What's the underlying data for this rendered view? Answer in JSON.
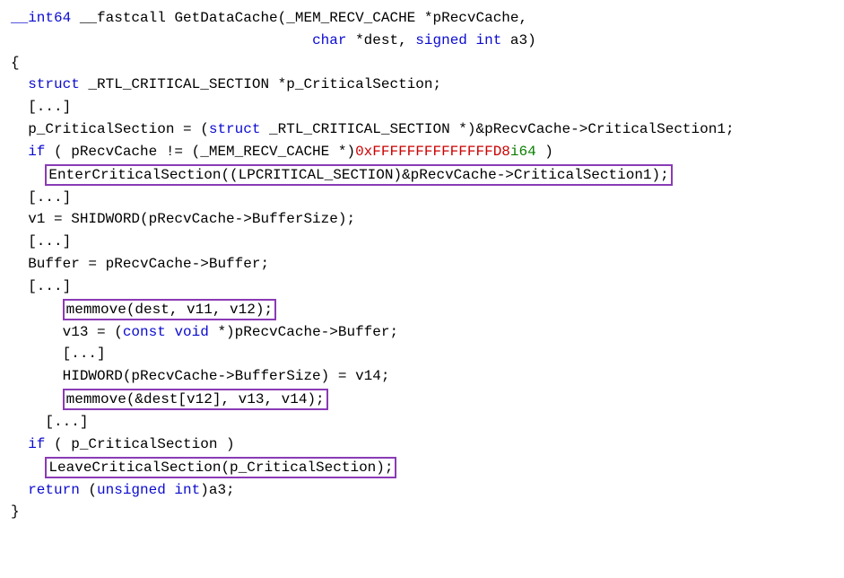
{
  "code": {
    "l01a": "__int64",
    "l01b": " __fastcall GetDataCache(_MEM_RECV_CACHE *pRecvCache,",
    "l02a": "                                   ",
    "l02b": "char",
    "l02c": " *dest, ",
    "l02d": "signed int",
    "l02e": " a3)",
    "l03": "{",
    "l04a": "  ",
    "l04b": "struct",
    "l04c": " _RTL_CRITICAL_SECTION *p_CriticalSection;",
    "l05": "  [...]",
    "l06a": "  p_CriticalSection = (",
    "l06b": "struct",
    "l06c": " _RTL_CRITICAL_SECTION *)&pRecvCache->CriticalSection1;",
    "l07a": "  ",
    "l07b": "if",
    "l07c": " ( pRecvCache != (_MEM_RECV_CACHE *)",
    "l07d": "0xFFFFFFFFFFFFFFD8",
    "l07e": "i64",
    "l07f": " )",
    "l08a": "    ",
    "l08b": "EnterCriticalSection((LPCRITICAL_SECTION)&pRecvCache->CriticalSection1);",
    "l09": "  [...]",
    "l10": "  v1 = SHIDWORD(pRecvCache->BufferSize);",
    "l11": "  [...]",
    "l12": "  Buffer = pRecvCache->Buffer;",
    "l13": "  [...]",
    "l14a": "      ",
    "l14b": "memmove(dest, v11, v12);",
    "l15a": "      v13 = (",
    "l15b": "const void",
    "l15c": " *)pRecvCache->Buffer;",
    "l16": "      [...]",
    "l17": "      HIDWORD(pRecvCache->BufferSize) = v14;",
    "l18a": "      ",
    "l18b": "memmove(&dest[v12], v13, v14);",
    "l19": "    [...]",
    "l20a": "  ",
    "l20b": "if",
    "l20c": " ( p_CriticalSection )",
    "l21a": "    ",
    "l21b": "LeaveCriticalSection(p_CriticalSection);",
    "l22a": "  ",
    "l22b": "return",
    "l22c": " (",
    "l22d": "unsigned int",
    "l22e": ")a3;",
    "l23": "}"
  }
}
